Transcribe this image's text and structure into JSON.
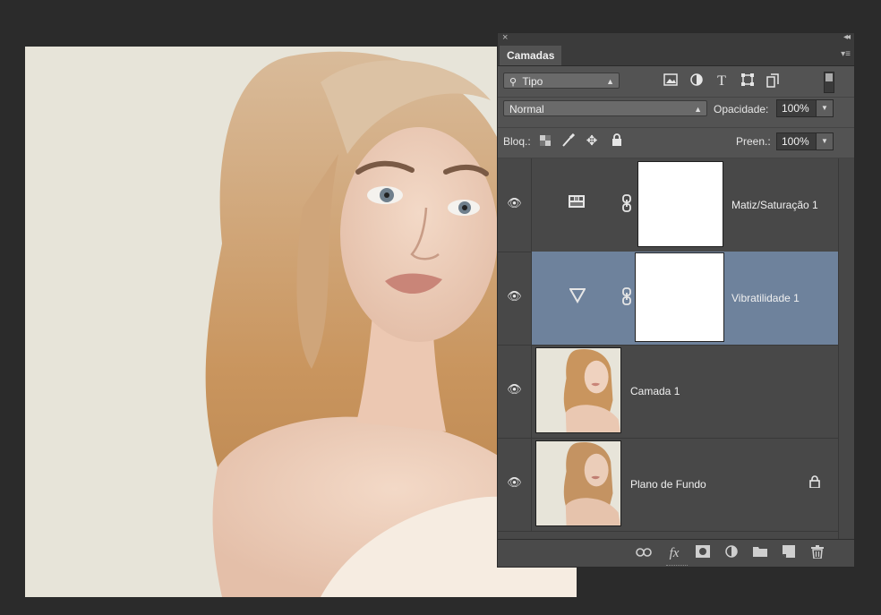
{
  "panel": {
    "close_glyph": "×",
    "collapse_glyph": "◂◂",
    "tab_label": "Camadas",
    "menu_glyph": "▾≡"
  },
  "filter": {
    "kind_label": "Tipo",
    "icons": [
      "image-filter-icon",
      "adjustment-filter-icon",
      "type-filter-icon",
      "shape-filter-icon",
      "smart-object-filter-icon"
    ]
  },
  "blend": {
    "mode": "Normal",
    "opacity_label": "Opacidade:",
    "opacity_value": "100%"
  },
  "lock": {
    "label": "Bloq.:",
    "fill_label": "Preen.:",
    "fill_value": "100%"
  },
  "layers": [
    {
      "name": "Matiz/Saturação 1",
      "type": "adjustment",
      "icon": "hue-saturation-icon",
      "selected": false,
      "locked": false
    },
    {
      "name": "Vibratilidade 1",
      "type": "adjustment",
      "icon": "vibrance-icon",
      "selected": true,
      "locked": false
    },
    {
      "name": "Camada 1",
      "type": "pixel",
      "selected": false,
      "locked": false
    },
    {
      "name": "Plano de Fundo",
      "type": "pixel",
      "selected": false,
      "locked": true
    }
  ],
  "bottom_buttons": [
    "link-layers-icon",
    "fx-icon",
    "add-mask-icon",
    "new-adjustment-icon",
    "new-group-icon",
    "new-layer-icon",
    "trash-icon"
  ],
  "bottom_fx_label": "fx",
  "colors": {
    "panel_bg": "#535353",
    "selected_row": "#6e829c",
    "canvas_bg": "#e7e4d9"
  }
}
